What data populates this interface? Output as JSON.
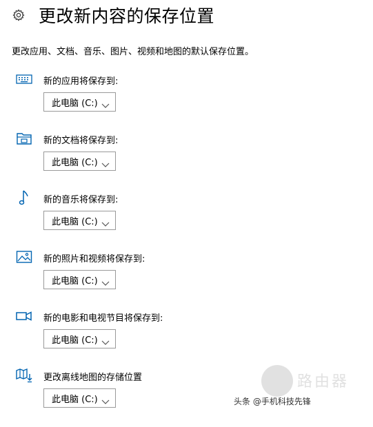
{
  "header": {
    "icon": "gear-icon",
    "title": "更改新内容的保存位置"
  },
  "description": "更改应用、文档、音乐、图片、视频和地图的默认保存位置。",
  "sections": [
    {
      "icon": "keyboard-icon",
      "label": "新的应用将保存到:",
      "value": "此电脑 (C:)"
    },
    {
      "icon": "folder-icon",
      "label": "新的文档将保存到:",
      "value": "此电脑 (C:)"
    },
    {
      "icon": "music-note-icon",
      "label": "新的音乐将保存到:",
      "value": "此电脑 (C:)"
    },
    {
      "icon": "picture-icon",
      "label": "新的照片和视频将保存到:",
      "value": "此电脑 (C:)"
    },
    {
      "icon": "video-camera-icon",
      "label": "新的电影和电视节目将保存到:",
      "value": "此电脑 (C:)"
    },
    {
      "icon": "map-download-icon",
      "label": "更改离线地图的存储位置",
      "value": "此电脑 (C:)"
    }
  ],
  "watermark": {
    "big": "路由器",
    "small": "头条 @手机科技先锋"
  },
  "colors": {
    "icon": "#0063b1",
    "border": "#999999",
    "text": "#000000"
  }
}
